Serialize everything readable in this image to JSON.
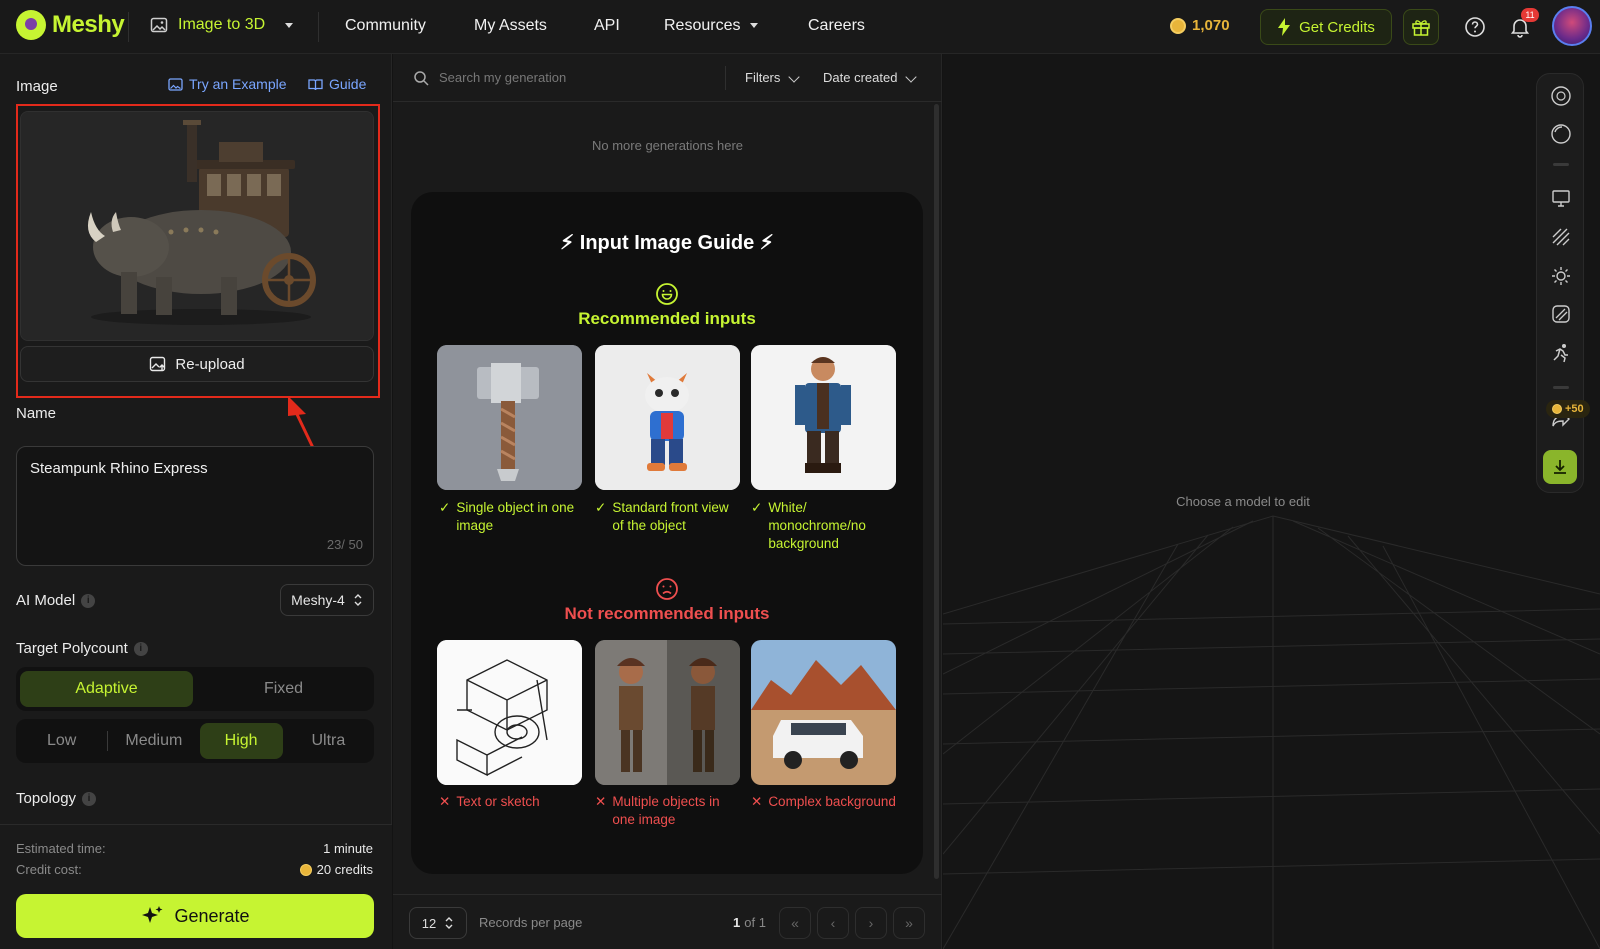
{
  "brand": {
    "name": "Meshy"
  },
  "topbar": {
    "mode_label": "Image to 3D",
    "nav": [
      "Community",
      "My Assets",
      "API",
      "Resources",
      "Careers"
    ],
    "credits": "1,070",
    "get_credits_label": "Get Credits",
    "notification_count": "11"
  },
  "left": {
    "image_label": "Image",
    "try_example": "Try an Example",
    "guide": "Guide",
    "reupload": "Re-upload",
    "name_label": "Name",
    "name_value": "Steampunk Rhino Express",
    "name_count": "23/ 50",
    "ai_model_label": "AI Model",
    "ai_model_value": "Meshy-4",
    "polycount_label": "Target Polycount",
    "polycount_modes": [
      "Adaptive",
      "Fixed"
    ],
    "polycount_mode_selected": "Adaptive",
    "polycount_levels": [
      "Low",
      "Medium",
      "High",
      "Ultra"
    ],
    "polycount_level_selected": "High",
    "topology_label": "Topology",
    "est_time_label": "Estimated time:",
    "est_time_value": "1 minute",
    "credit_cost_label": "Credit cost:",
    "credit_cost_value": "20 credits",
    "generate": "Generate"
  },
  "middle": {
    "search_placeholder": "Search my generation",
    "filters": "Filters",
    "sort": "Date created",
    "no_more": "No more generations here",
    "guide_title": "Input Image Guide",
    "recommended_title": "Recommended inputs",
    "recommended": [
      {
        "caption": "Single object in one image"
      },
      {
        "caption": "Standard front view of the object"
      },
      {
        "caption": "White/ monochrome/no background"
      }
    ],
    "not_recommended_title": "Not recommended inputs",
    "not_recommended": [
      {
        "caption": "Text or sketch"
      },
      {
        "caption": "Multiple objects in one image"
      },
      {
        "caption": "Complex background"
      }
    ],
    "per_page": "12",
    "per_page_label": "Records per page",
    "page_current": "1",
    "page_of": "of 1"
  },
  "viewport": {
    "placeholder": "Choose a model to edit",
    "reward_badge": "+50"
  },
  "colors": {
    "accent": "#c6f432",
    "danger": "#ef4f4f",
    "highlight": "#e32a1b",
    "link": "#7aa6ff",
    "coin": "#e8b53a"
  }
}
